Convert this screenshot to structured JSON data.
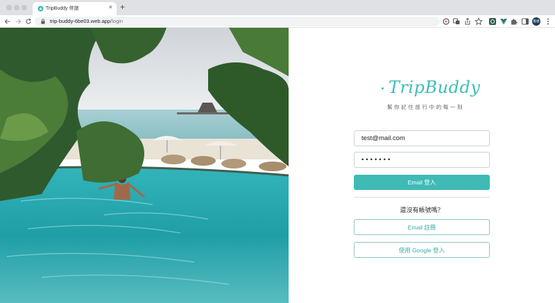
{
  "browser": {
    "tab_title": "TripBuddy 伴旅",
    "tab_close": "×",
    "new_tab": "+",
    "url_host": "trip-buddy-6be03.web.app",
    "url_path": "/login",
    "avatar_label": "帳號"
  },
  "brand": {
    "logo": "TripBuddy",
    "slogan": "幫你記住旅行中的每一刻",
    "accent_color": "#3fbab5"
  },
  "login": {
    "email_value": "test@mail.com",
    "password_value": "•••••••",
    "email_login_label": "Email 登入",
    "signup_question": "還沒有帳號嗎？",
    "email_signup_label": "Email 註冊",
    "google_login_label": "使用 Google 登入"
  }
}
